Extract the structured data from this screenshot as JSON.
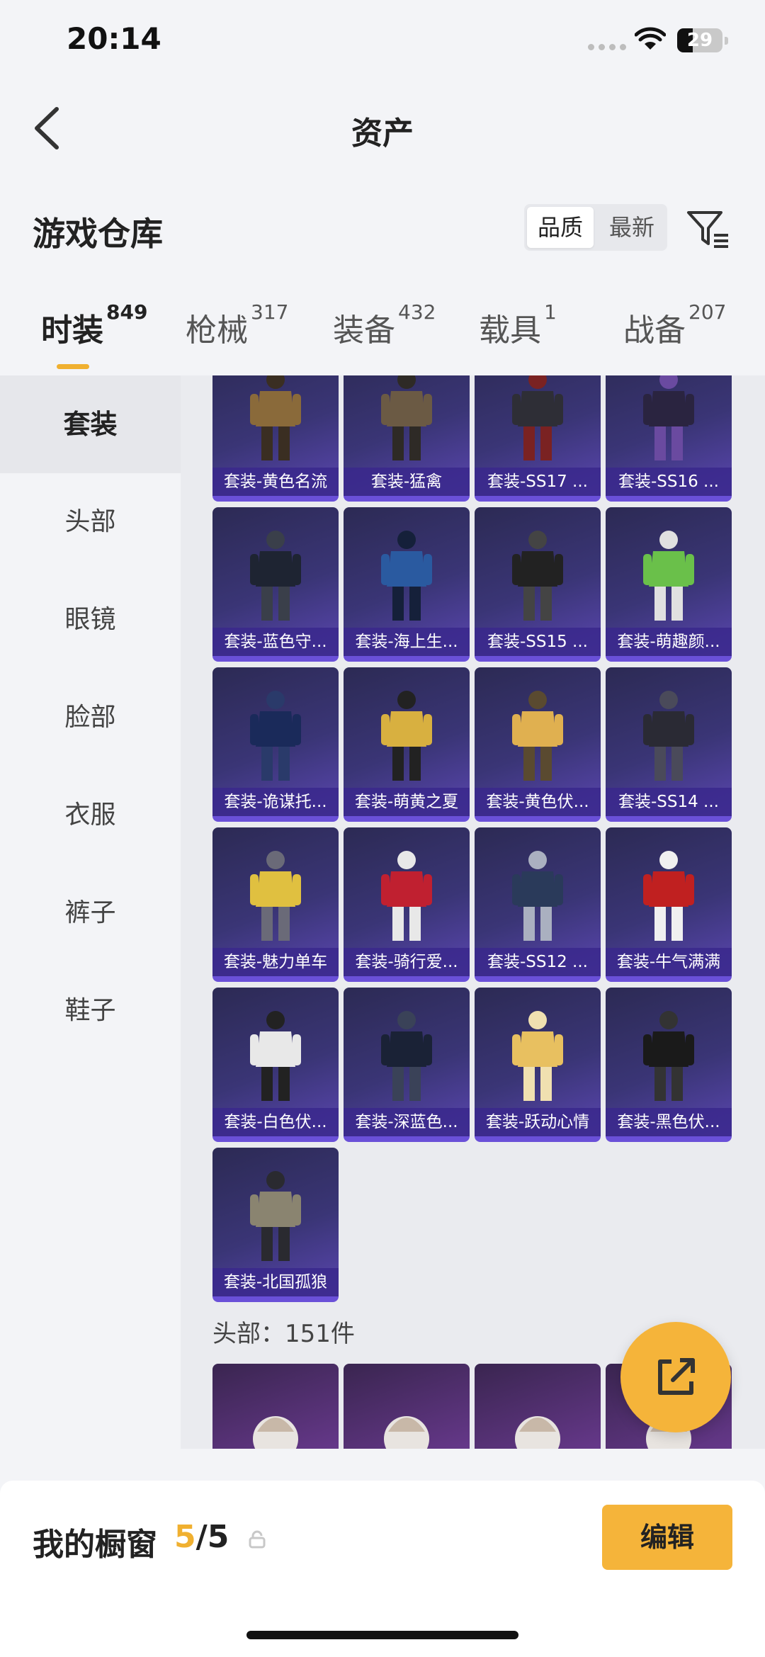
{
  "status": {
    "time": "20:14",
    "battery": "29"
  },
  "nav": {
    "title": "资产"
  },
  "warehouse": {
    "title": "游戏仓库",
    "sort_quality": "品质",
    "sort_latest": "最新"
  },
  "tabs": [
    {
      "label": "时装",
      "count": "849"
    },
    {
      "label": "枪械",
      "count": "317"
    },
    {
      "label": "装备",
      "count": "432"
    },
    {
      "label": "载具",
      "count": "1"
    },
    {
      "label": "战备",
      "count": "207"
    }
  ],
  "sidebar": {
    "items": [
      "套装",
      "头部",
      "眼镜",
      "脸部",
      "衣服",
      "裤子",
      "鞋子"
    ]
  },
  "outfits": [
    "套装-黄色名流",
    "套装-猛禽",
    "套装-SS17 ...",
    "套装-SS16 ...",
    "套装-蓝色守...",
    "套装-海上生...",
    "套装-SS15 ...",
    "套装-萌趣颜...",
    "套装-诡谋托...",
    "套装-萌黄之夏",
    "套装-黄色伏...",
    "套装-SS14 ...",
    "套装-魅力单车",
    "套装-骑行爱...",
    "套装-SS12 ...",
    "套装-牛气满满",
    "套装-白色伏...",
    "套装-深蓝色...",
    "套装-跃动心情",
    "套装-黑色伏...",
    "套装-北国孤狼"
  ],
  "head_section": {
    "title": "头部：151件"
  },
  "showcase": {
    "label": "我的橱窗",
    "current": "5",
    "total": "/5",
    "edit_label": "编辑"
  },
  "colors": {
    "accent": "#f5b43a",
    "card_bg": "#3a3576"
  },
  "icons": [
    "back-icon",
    "filter-icon",
    "share-icon",
    "lock-icon",
    "wifi-icon",
    "battery-icon"
  ]
}
